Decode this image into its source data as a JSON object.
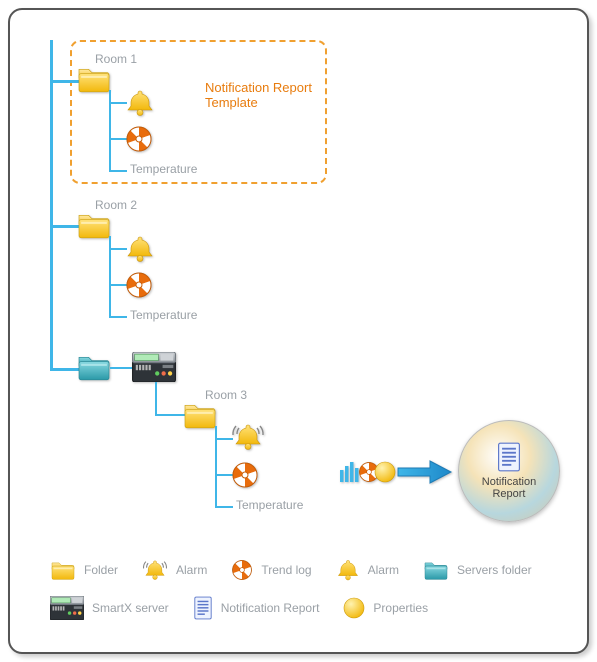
{
  "rooms": {
    "r1": {
      "title": "Room 1",
      "temp": "Temperature"
    },
    "r2": {
      "title": "Room 2",
      "temp": "Temperature"
    },
    "r3": {
      "title": "Room 3",
      "temp": "Temperature"
    }
  },
  "template_label": "Notification Report Template",
  "result_label": "Notification\nReport",
  "legend": {
    "folder": "Folder",
    "alarm_ring": "Alarm",
    "trend": "Trend log",
    "alarm_bell": "Alarm",
    "servers_folder": "Servers folder",
    "smartx": "SmartX server",
    "notif_report": "Notification Report",
    "properties": "Properties"
  }
}
